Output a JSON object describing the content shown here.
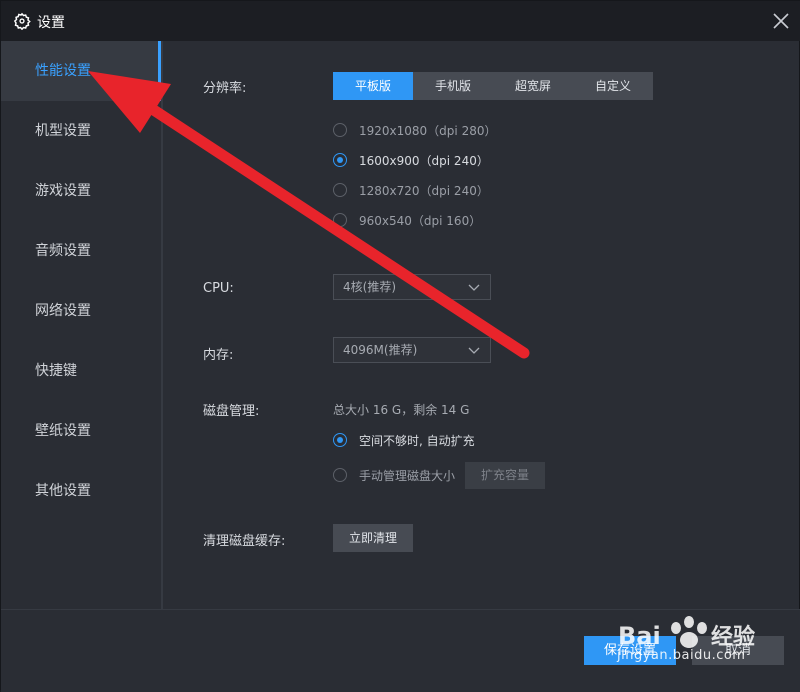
{
  "window": {
    "title": "设置"
  },
  "sidebar": {
    "items": [
      {
        "label": "性能设置",
        "active": true
      },
      {
        "label": "机型设置"
      },
      {
        "label": "游戏设置"
      },
      {
        "label": "音频设置"
      },
      {
        "label": "网络设置"
      },
      {
        "label": "快捷键"
      },
      {
        "label": "壁纸设置"
      },
      {
        "label": "其他设置"
      }
    ]
  },
  "resolution": {
    "label": "分辨率:",
    "tabs": [
      "平板版",
      "手机版",
      "超宽屏",
      "自定义"
    ],
    "active_tab": "平板版",
    "options": [
      "1920x1080（dpi 280）",
      "1600x900（dpi 240）",
      "1280x720（dpi 240）",
      "960x540（dpi 160）"
    ],
    "selected": "1600x900（dpi 240）"
  },
  "cpu": {
    "label": "CPU:",
    "value": "4核(推荐)"
  },
  "memory": {
    "label": "内存:",
    "value": "4096M(推荐)"
  },
  "disk": {
    "label": "磁盘管理:",
    "info": "总大小 16 G，剩余 14 G",
    "options": [
      "空间不够时, 自动扩充",
      "手动管理磁盘大小"
    ],
    "selected": "空间不够时, 自动扩充",
    "expand_button": "扩充容量"
  },
  "cache": {
    "label": "清理磁盘缓存:",
    "button": "立即清理"
  },
  "footer": {
    "save": "保存设置",
    "cancel": "取消"
  },
  "watermark": {
    "brand": "Bai du 经验",
    "url": "jingyan.baidu.com"
  },
  "colors": {
    "accent": "#2f97f5",
    "arrow": "#e8242b",
    "background": "#2a2d34"
  }
}
